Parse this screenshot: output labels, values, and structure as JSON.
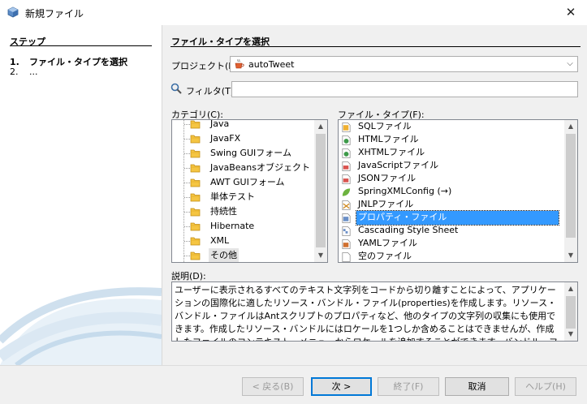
{
  "window": {
    "title": "新規ファイル",
    "close": "✕"
  },
  "steps": {
    "heading": "ステップ",
    "items": [
      {
        "num": "1.",
        "label": "ファイル・タイプを選択"
      },
      {
        "num": "2.",
        "label": "..."
      }
    ]
  },
  "main": {
    "title": "ファイル・タイプを選択",
    "project_label": "プロジェクト(P):",
    "project_value": "autoTweet",
    "filter_label": "フィルタ(T):",
    "filter_value": "",
    "categories_label": "カテゴリ(C):",
    "filetypes_label": "ファイル・タイプ(F):",
    "description_label": "説明(D):"
  },
  "categories": [
    "Java",
    "JavaFX",
    "Swing GUIフォーム",
    "JavaBeansオブジェクト",
    "AWT GUIフォーム",
    "単体テスト",
    "持続性",
    "Hibernate",
    "XML",
    "その他"
  ],
  "selected_category": "その他",
  "filetypes": [
    {
      "label": "SQLファイル",
      "icon": "sql-file-icon"
    },
    {
      "label": "HTMLファイル",
      "icon": "html-file-icon"
    },
    {
      "label": "XHTMLファイル",
      "icon": "xhtml-file-icon"
    },
    {
      "label": "JavaScriptファイル",
      "icon": "javascript-file-icon"
    },
    {
      "label": "JSONファイル",
      "icon": "json-file-icon"
    },
    {
      "label": "SpringXMLConfig (→)",
      "icon": "spring-leaf-icon"
    },
    {
      "label": "JNLPファイル",
      "icon": "jnlp-file-icon"
    },
    {
      "label": "プロパティ・ファイル",
      "icon": "properties-file-icon"
    },
    {
      "label": "Cascading Style Sheet",
      "icon": "css-file-icon"
    },
    {
      "label": "YAMLファイル",
      "icon": "yaml-file-icon"
    },
    {
      "label": "空のファイル",
      "icon": "empty-file-icon"
    }
  ],
  "selected_filetype": "プロパティ・ファイル",
  "description": "ユーザーに表示されるすべてのテキスト文字列をコードから切り離すことによって、アプリケーションの国際化に適したリソース・バンドル・ファイル(properties)を作成します。リソース・バンドル・ファイルはAntスクリプトのプロパティなど、他のタイプの文字列の収集にも使用できます。作成したリソース・バンドルにはロケールを1つしか含めることはできませんが、作成したファイルのコンテキスト・メニューからロケールを追加することができます。バンドル・ファイルは、特定のロケールのテキストを、パックしたプロパティ形式で含む",
  "buttons": {
    "back": "< 戻る(B)",
    "next": "次 >",
    "finish": "終了(F)",
    "cancel": "取消",
    "help": "ヘルプ(H)"
  },
  "colors": {
    "selection": "#3399ff",
    "accent": "#0078d7"
  }
}
